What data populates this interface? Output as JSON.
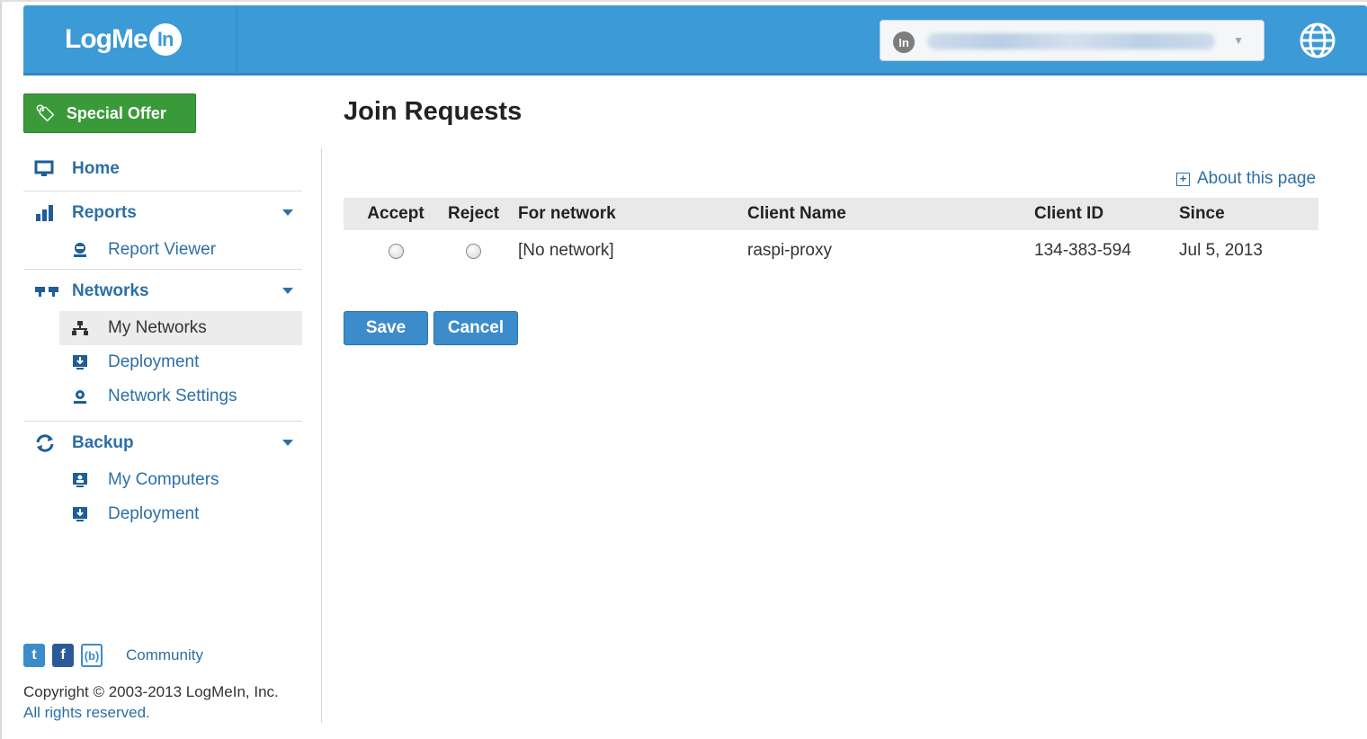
{
  "header": {
    "logo_text": "LogMe",
    "logo_badge": "In",
    "account_icon": "In",
    "account_value": ""
  },
  "sidebar": {
    "special_offer": "Special Offer",
    "items": [
      {
        "label": "Home",
        "icon": "monitor-icon"
      },
      {
        "label": "Reports",
        "icon": "bar-chart-icon",
        "children": [
          {
            "label": "Report Viewer",
            "icon": "report-viewer-icon"
          }
        ]
      },
      {
        "label": "Networks",
        "icon": "networks-icon",
        "children": [
          {
            "label": "My Networks",
            "icon": "network-tree-icon",
            "active": true
          },
          {
            "label": "Deployment",
            "icon": "deployment-icon"
          },
          {
            "label": "Network Settings",
            "icon": "network-settings-icon"
          }
        ]
      },
      {
        "label": "Backup",
        "icon": "refresh-icon",
        "children": [
          {
            "label": "My Computers",
            "icon": "computer-icon"
          },
          {
            "label": "Deployment",
            "icon": "deployment-icon"
          }
        ]
      }
    ]
  },
  "footer": {
    "community": "Community",
    "copyright_line1": "Copyright © 2003-2013 LogMeIn, Inc.",
    "copyright_line2": "All rights reserved."
  },
  "main": {
    "title": "Join Requests",
    "about_link": "About this page",
    "columns": [
      "Accept",
      "Reject",
      "For network",
      "Client Name",
      "Client ID",
      "Since"
    ],
    "rows": [
      {
        "network": "[No network]",
        "client_name": "raspi-proxy",
        "client_id": "134-383-594",
        "since": "Jul 5, 2013"
      }
    ],
    "save_label": "Save",
    "cancel_label": "Cancel"
  },
  "colors": {
    "header_blue": "#3c9ad6",
    "link_blue": "#2d6fa6",
    "offer_green": "#3a9a3a",
    "button_blue": "#3c8ccb"
  }
}
